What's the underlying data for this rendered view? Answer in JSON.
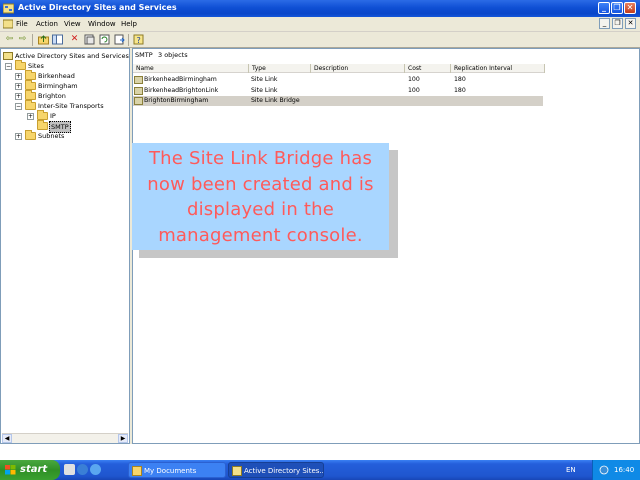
{
  "window": {
    "title": "Active Directory Sites and Services",
    "controls": [
      "_",
      "❐",
      "✕"
    ]
  },
  "menu": {
    "items": [
      "File",
      "Action",
      "View",
      "Window",
      "Help"
    ],
    "mdi_controls": [
      "_",
      "❐",
      "✕"
    ]
  },
  "toolbar": {
    "buttons": [
      "back-arrow-icon",
      "forward-arrow-icon",
      "up-folder-icon",
      "show-hide-tree-icon",
      "delete-icon",
      "properties-icon",
      "refresh-icon",
      "export-list-icon",
      "help-icon"
    ]
  },
  "tree": {
    "root": "Active Directory Sites and Services [a",
    "sites": "Sites",
    "site_items": [
      "Birkenhead",
      "Birmingham",
      "Brighton"
    ],
    "inter_site": "Inter-Site Transports",
    "ip": "IP",
    "smtp": "SMTP",
    "subnets": "Subnets"
  },
  "right_pane": {
    "location": "SMTP",
    "count": "3 objects",
    "columns": [
      "Name",
      "Type",
      "Description",
      "Cost",
      "Replication Interval"
    ],
    "rows": [
      {
        "name": "BirkenheadBirmingham",
        "type": "Site Link",
        "description": "",
        "cost": "100",
        "interval": "180"
      },
      {
        "name": "BirkenheadBrightonLink",
        "type": "Site Link",
        "description": "",
        "cost": "100",
        "interval": "180"
      },
      {
        "name": "BrightonBirmingham",
        "type": "Site Link Bridge",
        "description": "",
        "cost": "",
        "interval": ""
      }
    ]
  },
  "callout": {
    "text": "The Site Link Bridge has now been created and is displayed in the management console."
  },
  "taskbar": {
    "start": "start",
    "tasks": [
      "My Documents",
      "Active Directory Sites..."
    ],
    "language": "EN",
    "clock": "16:40"
  },
  "colors": {
    "titlebar": "#0f4fd4",
    "callout_bg": "#a9d6ff",
    "callout_text": "#ff5a5a",
    "taskbar": "#245edb",
    "start": "#2f8f25"
  }
}
